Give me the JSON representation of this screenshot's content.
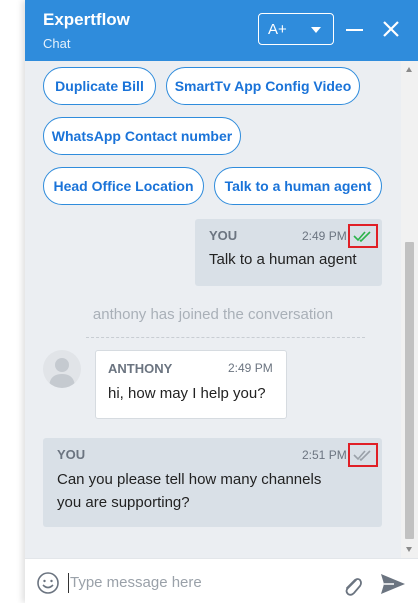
{
  "header": {
    "title": "Expertflow",
    "subtitle": "Chat",
    "font_size_label": "A+"
  },
  "quick_replies": [
    {
      "label": "Duplicate Bill"
    },
    {
      "label": "SmartTv App Config Video"
    },
    {
      "label": "WhatsApp Contact number"
    },
    {
      "label": "Head Office Location"
    },
    {
      "label": "Talk to a human agent"
    }
  ],
  "messages": [
    {
      "sender": "YOU",
      "time": "2:49 PM",
      "text": "Talk to a human agent",
      "status": "read"
    },
    {
      "sender": "ANTHONY",
      "time": "2:49 PM",
      "text": "hi, how may I help you?"
    },
    {
      "sender": "YOU",
      "time": "2:51 PM",
      "text_line1": "Can you please tell how many channels",
      "text_line2": "you are supporting?",
      "status": "delivered"
    }
  ],
  "system_message": "anthony has joined the conversation",
  "composer": {
    "placeholder": "Type message here"
  },
  "colors": {
    "header": "#2f8cdc",
    "quick_reply_text": "#1a73d8",
    "read_check": "#2cb34a",
    "delivered_check": "#9aa1a9",
    "highlight": "#e01f26"
  }
}
